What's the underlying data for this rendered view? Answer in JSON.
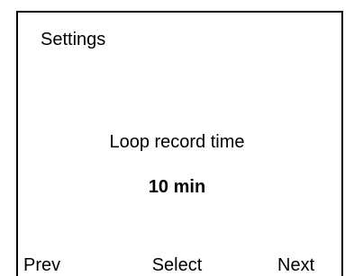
{
  "screen": {
    "title": "Settings"
  },
  "setting": {
    "label": "Loop record time",
    "value": "10 min"
  },
  "softkeys": {
    "prev": "Prev",
    "select": "Select",
    "next": "Next"
  }
}
